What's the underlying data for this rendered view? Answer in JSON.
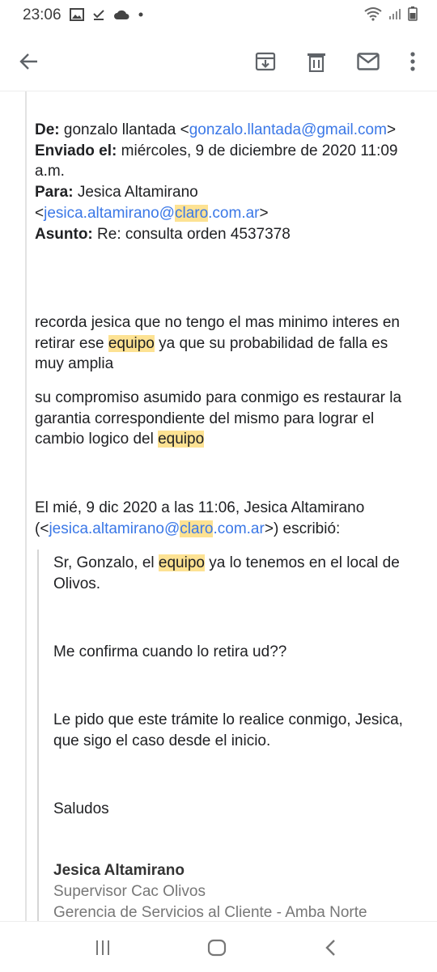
{
  "status_bar": {
    "time": "23:06"
  },
  "toolbar": {
    "back_icon": "arrow-left-icon",
    "archive_icon": "archive-icon",
    "delete_icon": "trash-icon",
    "mark_unread_icon": "mail-icon",
    "more_icon": "more-vert-icon"
  },
  "email": {
    "from_label": "De:",
    "from_name": "gonzalo llantada",
    "from_email_lt": "<",
    "from_email": "gonzalo.llantada@gmail.com",
    "from_email_gt": ">",
    "sent_label": "Enviado el:",
    "sent_value": "miércoles, 9 de diciembre de 2020 11:09 a.m.",
    "to_label": "Para:",
    "to_name": "Jesica Altamirano",
    "to_email_a": "jesica.altamirano@",
    "to_email_hl": "claro",
    "to_email_b": ".com.ar",
    "subject_label": "Asunto:",
    "subject_value": "Re: consulta orden 4537378",
    "p1_a": "recorda jesica que no tengo el mas minimo interes en retirar ese ",
    "p1_hl": "equipo",
    "p1_b": " ya que su probabilidad de falla es muy amplia",
    "p2_a": "su compromiso asumido para conmigo es restaurar la garantia correspondiente del mismo para lograr el cambio logico del ",
    "p2_hl": "equipo",
    "quote_intro_a": "El mié, 9 dic 2020 a las 11:06, Jesica Altamirano (<",
    "quote_intro_link_a": "jesica.altamirano@",
    "quote_intro_link_hl": "claro",
    "quote_intro_link_b": ".com.ar",
    "quote_intro_b": ">) escribió:",
    "quoted": {
      "q1_a": "Sr, Gonzalo, el ",
      "q1_hl": "equipo",
      "q1_b": " ya lo tenemos en el local de Olivos.",
      "q2": "Me confirma cuando lo retira ud??",
      "q3": "Le pido que este trámite lo realice conmigo, Jesica, que sigo el caso desde el inicio.",
      "q4": "Saludos",
      "sig_name": "Jesica Altamirano",
      "sig_title": "Supervisor Cac Olivos",
      "sig_dept": "Gerencia de Servicios al Cliente - Amba Norte"
    }
  },
  "nav_bar": {
    "recents_icon": "recents-icon",
    "home_icon": "home-icon",
    "back_icon": "nav-back-icon"
  }
}
